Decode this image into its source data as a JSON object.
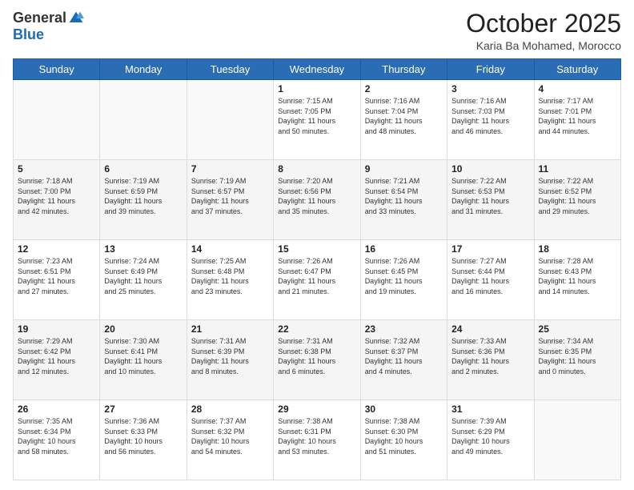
{
  "logo": {
    "general": "General",
    "blue": "Blue"
  },
  "header": {
    "month": "October 2025",
    "location": "Karia Ba Mohamed, Morocco"
  },
  "weekdays": [
    "Sunday",
    "Monday",
    "Tuesday",
    "Wednesday",
    "Thursday",
    "Friday",
    "Saturday"
  ],
  "weeks": [
    [
      {
        "day": "",
        "info": ""
      },
      {
        "day": "",
        "info": ""
      },
      {
        "day": "",
        "info": ""
      },
      {
        "day": "1",
        "info": "Sunrise: 7:15 AM\nSunset: 7:05 PM\nDaylight: 11 hours\nand 50 minutes."
      },
      {
        "day": "2",
        "info": "Sunrise: 7:16 AM\nSunset: 7:04 PM\nDaylight: 11 hours\nand 48 minutes."
      },
      {
        "day": "3",
        "info": "Sunrise: 7:16 AM\nSunset: 7:03 PM\nDaylight: 11 hours\nand 46 minutes."
      },
      {
        "day": "4",
        "info": "Sunrise: 7:17 AM\nSunset: 7:01 PM\nDaylight: 11 hours\nand 44 minutes."
      }
    ],
    [
      {
        "day": "5",
        "info": "Sunrise: 7:18 AM\nSunset: 7:00 PM\nDaylight: 11 hours\nand 42 minutes."
      },
      {
        "day": "6",
        "info": "Sunrise: 7:19 AM\nSunset: 6:59 PM\nDaylight: 11 hours\nand 39 minutes."
      },
      {
        "day": "7",
        "info": "Sunrise: 7:19 AM\nSunset: 6:57 PM\nDaylight: 11 hours\nand 37 minutes."
      },
      {
        "day": "8",
        "info": "Sunrise: 7:20 AM\nSunset: 6:56 PM\nDaylight: 11 hours\nand 35 minutes."
      },
      {
        "day": "9",
        "info": "Sunrise: 7:21 AM\nSunset: 6:54 PM\nDaylight: 11 hours\nand 33 minutes."
      },
      {
        "day": "10",
        "info": "Sunrise: 7:22 AM\nSunset: 6:53 PM\nDaylight: 11 hours\nand 31 minutes."
      },
      {
        "day": "11",
        "info": "Sunrise: 7:22 AM\nSunset: 6:52 PM\nDaylight: 11 hours\nand 29 minutes."
      }
    ],
    [
      {
        "day": "12",
        "info": "Sunrise: 7:23 AM\nSunset: 6:51 PM\nDaylight: 11 hours\nand 27 minutes."
      },
      {
        "day": "13",
        "info": "Sunrise: 7:24 AM\nSunset: 6:49 PM\nDaylight: 11 hours\nand 25 minutes."
      },
      {
        "day": "14",
        "info": "Sunrise: 7:25 AM\nSunset: 6:48 PM\nDaylight: 11 hours\nand 23 minutes."
      },
      {
        "day": "15",
        "info": "Sunrise: 7:26 AM\nSunset: 6:47 PM\nDaylight: 11 hours\nand 21 minutes."
      },
      {
        "day": "16",
        "info": "Sunrise: 7:26 AM\nSunset: 6:45 PM\nDaylight: 11 hours\nand 19 minutes."
      },
      {
        "day": "17",
        "info": "Sunrise: 7:27 AM\nSunset: 6:44 PM\nDaylight: 11 hours\nand 16 minutes."
      },
      {
        "day": "18",
        "info": "Sunrise: 7:28 AM\nSunset: 6:43 PM\nDaylight: 11 hours\nand 14 minutes."
      }
    ],
    [
      {
        "day": "19",
        "info": "Sunrise: 7:29 AM\nSunset: 6:42 PM\nDaylight: 11 hours\nand 12 minutes."
      },
      {
        "day": "20",
        "info": "Sunrise: 7:30 AM\nSunset: 6:41 PM\nDaylight: 11 hours\nand 10 minutes."
      },
      {
        "day": "21",
        "info": "Sunrise: 7:31 AM\nSunset: 6:39 PM\nDaylight: 11 hours\nand 8 minutes."
      },
      {
        "day": "22",
        "info": "Sunrise: 7:31 AM\nSunset: 6:38 PM\nDaylight: 11 hours\nand 6 minutes."
      },
      {
        "day": "23",
        "info": "Sunrise: 7:32 AM\nSunset: 6:37 PM\nDaylight: 11 hours\nand 4 minutes."
      },
      {
        "day": "24",
        "info": "Sunrise: 7:33 AM\nSunset: 6:36 PM\nDaylight: 11 hours\nand 2 minutes."
      },
      {
        "day": "25",
        "info": "Sunrise: 7:34 AM\nSunset: 6:35 PM\nDaylight: 11 hours\nand 0 minutes."
      }
    ],
    [
      {
        "day": "26",
        "info": "Sunrise: 7:35 AM\nSunset: 6:34 PM\nDaylight: 10 hours\nand 58 minutes."
      },
      {
        "day": "27",
        "info": "Sunrise: 7:36 AM\nSunset: 6:33 PM\nDaylight: 10 hours\nand 56 minutes."
      },
      {
        "day": "28",
        "info": "Sunrise: 7:37 AM\nSunset: 6:32 PM\nDaylight: 10 hours\nand 54 minutes."
      },
      {
        "day": "29",
        "info": "Sunrise: 7:38 AM\nSunset: 6:31 PM\nDaylight: 10 hours\nand 53 minutes."
      },
      {
        "day": "30",
        "info": "Sunrise: 7:38 AM\nSunset: 6:30 PM\nDaylight: 10 hours\nand 51 minutes."
      },
      {
        "day": "31",
        "info": "Sunrise: 7:39 AM\nSunset: 6:29 PM\nDaylight: 10 hours\nand 49 minutes."
      },
      {
        "day": "",
        "info": ""
      }
    ]
  ]
}
